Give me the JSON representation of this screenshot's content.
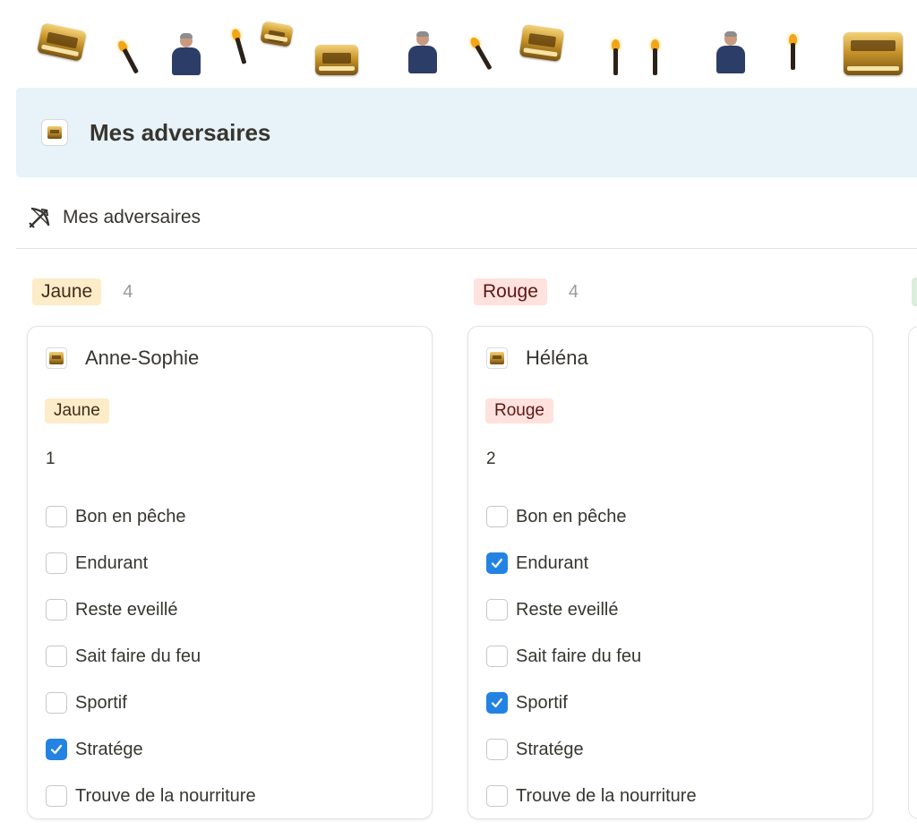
{
  "page": {
    "callout_title": "Mes adversaires"
  },
  "view": {
    "label": "Mes adversaires",
    "icon": "bow-arrow-icon"
  },
  "colors": {
    "callout_bg": "#e7f3f8",
    "jaune_bg": "#fdecc8",
    "jaune_text": "#402c1b",
    "rouge_bg": "#ffe2dd",
    "rouge_text": "#5d1715",
    "checkbox_checked": "#2383e2"
  },
  "groups": [
    {
      "name": "Jaune",
      "count": "4",
      "cards": [
        {
          "title": "Anne-Sophie",
          "tag": "Jaune",
          "number": "1",
          "properties": [
            {
              "label": "Bon en pêche",
              "checked": false
            },
            {
              "label": "Endurant",
              "checked": false
            },
            {
              "label": "Reste eveillé",
              "checked": false
            },
            {
              "label": "Sait faire du feu",
              "checked": false
            },
            {
              "label": "Sportif",
              "checked": false
            },
            {
              "label": "Stratége",
              "checked": true
            },
            {
              "label": "Trouve de la nourriture",
              "checked": false
            }
          ]
        }
      ]
    },
    {
      "name": "Rouge",
      "count": "4",
      "cards": [
        {
          "title": "Héléna",
          "tag": "Rouge",
          "number": "2",
          "properties": [
            {
              "label": "Bon en pêche",
              "checked": false
            },
            {
              "label": "Endurant",
              "checked": true
            },
            {
              "label": "Reste eveillé",
              "checked": false
            },
            {
              "label": "Sait faire du feu",
              "checked": false
            },
            {
              "label": "Sportif",
              "checked": true
            },
            {
              "label": "Stratége",
              "checked": false
            },
            {
              "label": "Trouve de la nourriture",
              "checked": false
            }
          ]
        }
      ]
    }
  ]
}
